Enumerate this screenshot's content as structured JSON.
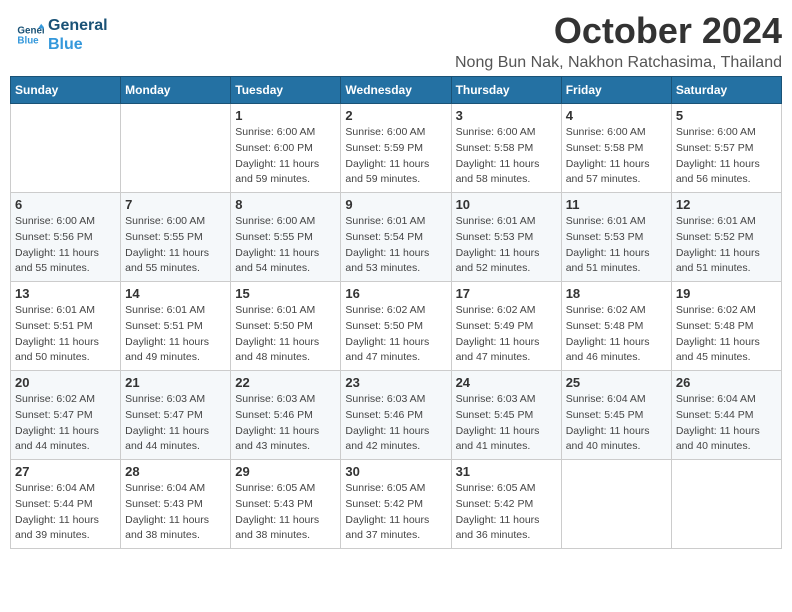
{
  "header": {
    "logo_line1": "General",
    "logo_line2": "Blue",
    "month": "October 2024",
    "location": "Nong Bun Nak, Nakhon Ratchasima, Thailand"
  },
  "days_of_week": [
    "Sunday",
    "Monday",
    "Tuesday",
    "Wednesday",
    "Thursday",
    "Friday",
    "Saturday"
  ],
  "weeks": [
    [
      {
        "day": "",
        "info": ""
      },
      {
        "day": "",
        "info": ""
      },
      {
        "day": "1",
        "info": "Sunrise: 6:00 AM\nSunset: 6:00 PM\nDaylight: 11 hours and 59 minutes."
      },
      {
        "day": "2",
        "info": "Sunrise: 6:00 AM\nSunset: 5:59 PM\nDaylight: 11 hours and 59 minutes."
      },
      {
        "day": "3",
        "info": "Sunrise: 6:00 AM\nSunset: 5:58 PM\nDaylight: 11 hours and 58 minutes."
      },
      {
        "day": "4",
        "info": "Sunrise: 6:00 AM\nSunset: 5:58 PM\nDaylight: 11 hours and 57 minutes."
      },
      {
        "day": "5",
        "info": "Sunrise: 6:00 AM\nSunset: 5:57 PM\nDaylight: 11 hours and 56 minutes."
      }
    ],
    [
      {
        "day": "6",
        "info": "Sunrise: 6:00 AM\nSunset: 5:56 PM\nDaylight: 11 hours and 55 minutes."
      },
      {
        "day": "7",
        "info": "Sunrise: 6:00 AM\nSunset: 5:55 PM\nDaylight: 11 hours and 55 minutes."
      },
      {
        "day": "8",
        "info": "Sunrise: 6:00 AM\nSunset: 5:55 PM\nDaylight: 11 hours and 54 minutes."
      },
      {
        "day": "9",
        "info": "Sunrise: 6:01 AM\nSunset: 5:54 PM\nDaylight: 11 hours and 53 minutes."
      },
      {
        "day": "10",
        "info": "Sunrise: 6:01 AM\nSunset: 5:53 PM\nDaylight: 11 hours and 52 minutes."
      },
      {
        "day": "11",
        "info": "Sunrise: 6:01 AM\nSunset: 5:53 PM\nDaylight: 11 hours and 51 minutes."
      },
      {
        "day": "12",
        "info": "Sunrise: 6:01 AM\nSunset: 5:52 PM\nDaylight: 11 hours and 51 minutes."
      }
    ],
    [
      {
        "day": "13",
        "info": "Sunrise: 6:01 AM\nSunset: 5:51 PM\nDaylight: 11 hours and 50 minutes."
      },
      {
        "day": "14",
        "info": "Sunrise: 6:01 AM\nSunset: 5:51 PM\nDaylight: 11 hours and 49 minutes."
      },
      {
        "day": "15",
        "info": "Sunrise: 6:01 AM\nSunset: 5:50 PM\nDaylight: 11 hours and 48 minutes."
      },
      {
        "day": "16",
        "info": "Sunrise: 6:02 AM\nSunset: 5:50 PM\nDaylight: 11 hours and 47 minutes."
      },
      {
        "day": "17",
        "info": "Sunrise: 6:02 AM\nSunset: 5:49 PM\nDaylight: 11 hours and 47 minutes."
      },
      {
        "day": "18",
        "info": "Sunrise: 6:02 AM\nSunset: 5:48 PM\nDaylight: 11 hours and 46 minutes."
      },
      {
        "day": "19",
        "info": "Sunrise: 6:02 AM\nSunset: 5:48 PM\nDaylight: 11 hours and 45 minutes."
      }
    ],
    [
      {
        "day": "20",
        "info": "Sunrise: 6:02 AM\nSunset: 5:47 PM\nDaylight: 11 hours and 44 minutes."
      },
      {
        "day": "21",
        "info": "Sunrise: 6:03 AM\nSunset: 5:47 PM\nDaylight: 11 hours and 44 minutes."
      },
      {
        "day": "22",
        "info": "Sunrise: 6:03 AM\nSunset: 5:46 PM\nDaylight: 11 hours and 43 minutes."
      },
      {
        "day": "23",
        "info": "Sunrise: 6:03 AM\nSunset: 5:46 PM\nDaylight: 11 hours and 42 minutes."
      },
      {
        "day": "24",
        "info": "Sunrise: 6:03 AM\nSunset: 5:45 PM\nDaylight: 11 hours and 41 minutes."
      },
      {
        "day": "25",
        "info": "Sunrise: 6:04 AM\nSunset: 5:45 PM\nDaylight: 11 hours and 40 minutes."
      },
      {
        "day": "26",
        "info": "Sunrise: 6:04 AM\nSunset: 5:44 PM\nDaylight: 11 hours and 40 minutes."
      }
    ],
    [
      {
        "day": "27",
        "info": "Sunrise: 6:04 AM\nSunset: 5:44 PM\nDaylight: 11 hours and 39 minutes."
      },
      {
        "day": "28",
        "info": "Sunrise: 6:04 AM\nSunset: 5:43 PM\nDaylight: 11 hours and 38 minutes."
      },
      {
        "day": "29",
        "info": "Sunrise: 6:05 AM\nSunset: 5:43 PM\nDaylight: 11 hours and 38 minutes."
      },
      {
        "day": "30",
        "info": "Sunrise: 6:05 AM\nSunset: 5:42 PM\nDaylight: 11 hours and 37 minutes."
      },
      {
        "day": "31",
        "info": "Sunrise: 6:05 AM\nSunset: 5:42 PM\nDaylight: 11 hours and 36 minutes."
      },
      {
        "day": "",
        "info": ""
      },
      {
        "day": "",
        "info": ""
      }
    ]
  ]
}
